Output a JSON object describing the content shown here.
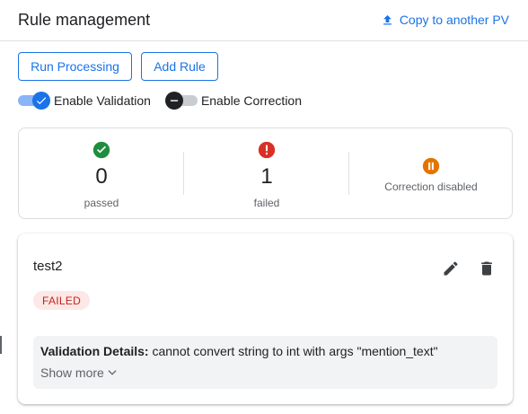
{
  "header": {
    "title": "Rule management",
    "copy_link": "Copy to another PV"
  },
  "actions": {
    "run_processing": "Run Processing",
    "add_rule": "Add Rule"
  },
  "toggles": {
    "validation": {
      "label": "Enable Validation",
      "enabled": true
    },
    "correction": {
      "label": "Enable Correction",
      "enabled": false
    }
  },
  "stats": {
    "passed": {
      "count": "0",
      "label": "passed",
      "icon": "check-circle-icon",
      "color": "#1e8e3e"
    },
    "failed": {
      "count": "1",
      "label": "failed",
      "icon": "error-circle-icon",
      "color": "#d93025"
    },
    "correction": {
      "label": "Correction disabled",
      "icon": "pause-circle-icon",
      "color": "#e37400"
    }
  },
  "rule": {
    "name": "test2",
    "status": "FAILED",
    "details_label": "Validation Details:",
    "details_text": "cannot convert string to int with args \"mention_text\"",
    "show_more": "Show more"
  },
  "colors": {
    "accent": "#1a73e8",
    "failed_bg": "#fce8e6",
    "failed_text": "#c5221f"
  }
}
